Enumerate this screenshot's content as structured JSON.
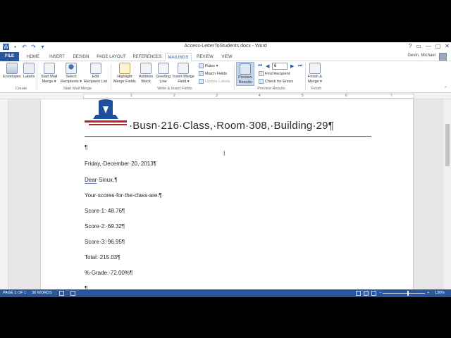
{
  "window": {
    "title": "Access-LetterToStudents.docx - Word",
    "controls": [
      "?",
      "▭",
      "—",
      "▢",
      "✕"
    ]
  },
  "quick_access": [
    "W",
    "▪",
    "↶",
    "↷",
    "▾"
  ],
  "tabs": [
    {
      "label": "FILE"
    },
    {
      "label": "HOME"
    },
    {
      "label": "INSERT"
    },
    {
      "label": "DESIGN"
    },
    {
      "label": "PAGE LAYOUT"
    },
    {
      "label": "REFERENCES"
    },
    {
      "label": "MAILINGS"
    },
    {
      "label": "REVIEW"
    },
    {
      "label": "VIEW"
    }
  ],
  "user": {
    "name": "Gevin, Michael"
  },
  "ribbon": {
    "create": {
      "envelopes": "Envelopes",
      "labels": "Labels",
      "group": "Create"
    },
    "start": {
      "start_mail_merge": "Start Mail\nMerge ▾",
      "select_recipients": "Select\nRecipients ▾",
      "edit_recipient_list": "Edit\nRecipient List",
      "group": "Start Mail Merge"
    },
    "write": {
      "highlight": "Highlight\nMerge Fields",
      "address_block": "Address\nBlock",
      "greeting_line": "Greeting\nLine",
      "insert_merge_field": "Insert Merge\nField ▾",
      "rules": "Rules ▾",
      "match_fields": "Match Fields",
      "update_labels": "Update Labels",
      "group": "Write & Insert Fields"
    },
    "preview": {
      "preview_results": "Preview\nResults",
      "record": "6",
      "find_recipient": "Find Recipient",
      "check_errors": "Check for Errors",
      "group": "Preview Results"
    },
    "finish": {
      "finish_merge": "Finish &\nMerge ▾",
      "group": "Finish"
    }
  },
  "ruler": {
    "numbers": [
      "1",
      "2",
      "3",
      "4",
      "5",
      "6",
      "7"
    ]
  },
  "document": {
    "heading_pre": "·Busn·216·Class,·Room·308,·Building·29¶",
    "lines": [
      "¶",
      "Friday,·December·20,·2013¶",
      "Dear·Sioux,¶",
      "Your·scores·for·the·class·are:¶",
      "Score·1:·48.76¶",
      "Score·2:·69.32¶",
      "Score·3:·96.95¶",
      "Total:·215.03¶",
      "%·Grade:·72.00%¶",
      "¶"
    ],
    "greeting_underlined": "Dear",
    "greeting_rest": "·Sioux,¶"
  },
  "status": {
    "page": "PAGE 1 OF 1",
    "words": "36 WORDS",
    "zoom": "130%"
  },
  "colors": {
    "accent": "#2b579a",
    "logo_red": "#b3262c",
    "logo_blue": "#1f4e9c"
  }
}
